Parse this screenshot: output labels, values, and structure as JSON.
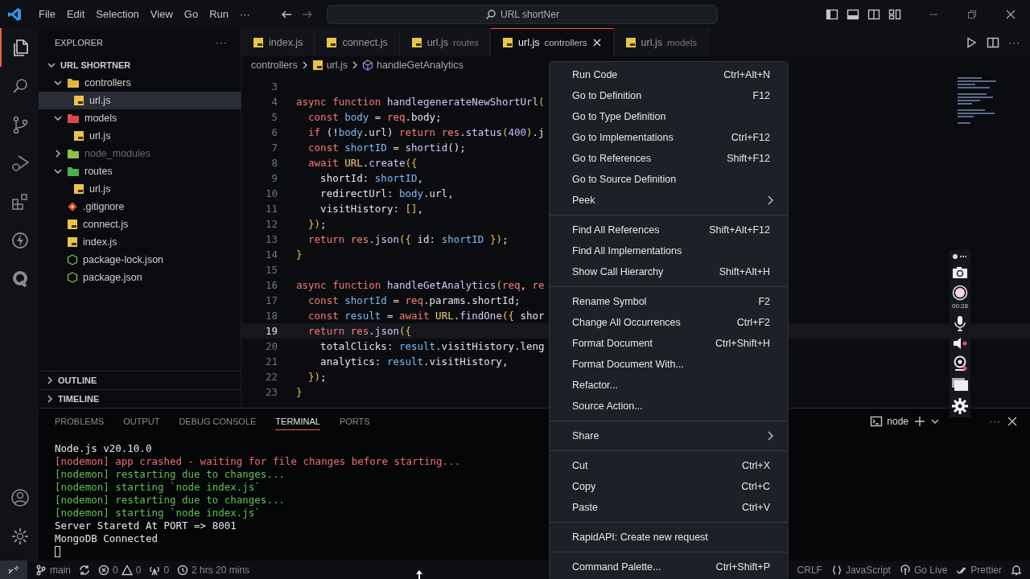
{
  "title_bar": {
    "menus": [
      "File",
      "Edit",
      "Selection",
      "View",
      "Go",
      "Run",
      "···"
    ],
    "search": "URL shortNer"
  },
  "explorer": {
    "title": "EXPLORER",
    "more": "···",
    "root": {
      "label": "URL SHORTNER",
      "expanded": true
    },
    "tree": [
      {
        "label": "controllers",
        "kind": "folder",
        "color": "#e2b63a",
        "expanded": true,
        "selected": false,
        "ignored": false,
        "children": [
          {
            "label": "url.js",
            "kind": "js",
            "selected": true,
            "ignored": false
          }
        ]
      },
      {
        "label": "models",
        "kind": "folder",
        "color": "#e0474f",
        "expanded": true,
        "selected": false,
        "ignored": false,
        "children": [
          {
            "label": "url.js",
            "kind": "js",
            "selected": false,
            "ignored": false
          }
        ]
      },
      {
        "label": "node_modules",
        "kind": "folder",
        "color": "#8bc34a",
        "expanded": false,
        "selected": false,
        "ignored": true
      },
      {
        "label": "routes",
        "kind": "folder",
        "color": "#4caf50",
        "expanded": true,
        "selected": false,
        "ignored": false,
        "children": [
          {
            "label": "url.js",
            "kind": "js",
            "selected": false,
            "ignored": false
          }
        ]
      },
      {
        "label": ".gitignore",
        "kind": "git",
        "selected": false,
        "ignored": false
      },
      {
        "label": "connect.js",
        "kind": "js",
        "selected": false,
        "ignored": false
      },
      {
        "label": "index.js",
        "kind": "js",
        "selected": false,
        "ignored": false
      },
      {
        "label": "package-lock.json",
        "kind": "npm",
        "selected": false,
        "ignored": false
      },
      {
        "label": "package.json",
        "kind": "npm",
        "selected": false,
        "ignored": false
      }
    ],
    "sections": [
      {
        "label": "OUTLINE",
        "expanded": false
      },
      {
        "label": "TIMELINE",
        "expanded": false
      }
    ]
  },
  "tabs": [
    {
      "label": "index.js",
      "selected": false
    },
    {
      "label": "connect.js",
      "selected": false
    },
    {
      "label": "url.js",
      "description": "routes",
      "selected": false
    },
    {
      "label": "url.js",
      "description": "controllers",
      "selected": true
    },
    {
      "label": "url.js",
      "description": "models",
      "selected": false
    }
  ],
  "breadcrumb": [
    {
      "label": "controllers",
      "kind": "folder"
    },
    {
      "label": "url.js",
      "kind": "js"
    },
    {
      "label": "handleGetAnalytics",
      "kind": "symbol"
    }
  ],
  "code": {
    "lines": [
      {
        "number": "3",
        "current": false
      },
      {
        "number": "4",
        "current": false,
        "tokens": [
          {
            "text": "async",
            "kind": "kw"
          },
          {
            "text": " function",
            "kind": "kw"
          },
          {
            "text": " handlegenerateNewShortUrl",
            "kind": "fn"
          },
          {
            "text": "(",
            "kind": "brace"
          }
        ]
      },
      {
        "number": "5",
        "current": false,
        "tokens": [
          {
            "text": "  const",
            "kind": "kw"
          },
          {
            "text": " body",
            "kind": "var"
          },
          {
            "text": " = ",
            "kind": "plain"
          },
          {
            "text": "req",
            "kind": "obj"
          },
          {
            "text": ".body;",
            "kind": "plain"
          }
        ]
      },
      {
        "number": "6",
        "current": false,
        "tokens": [
          {
            "text": "  if",
            "kind": "kw"
          },
          {
            "text": " (!",
            "kind": "plain"
          },
          {
            "text": "body",
            "kind": "var"
          },
          {
            "text": ".url) ",
            "kind": "plain"
          },
          {
            "text": "return",
            "kind": "kw"
          },
          {
            "text": " res",
            "kind": "obj"
          },
          {
            "text": ".",
            "kind": "plain"
          },
          {
            "text": "status",
            "kind": "fn"
          },
          {
            "text": "(",
            "kind": "brace"
          },
          {
            "text": "400",
            "kind": "num"
          },
          {
            "text": ")",
            "kind": "brace"
          },
          {
            "text": ".j",
            "kind": "plain"
          }
        ]
      },
      {
        "number": "7",
        "current": false,
        "tokens": [
          {
            "text": "  const",
            "kind": "kw"
          },
          {
            "text": " shortID",
            "kind": "var"
          },
          {
            "text": " = ",
            "kind": "plain"
          },
          {
            "text": "shortid",
            "kind": "fn"
          },
          {
            "text": "();",
            "kind": "plain"
          }
        ]
      },
      {
        "number": "8",
        "current": false,
        "tokens": [
          {
            "text": "  await",
            "kind": "kw"
          },
          {
            "text": " URL",
            "kind": "cls"
          },
          {
            "text": ".",
            "kind": "plain"
          },
          {
            "text": "create",
            "kind": "fn"
          },
          {
            "text": "({",
            "kind": "brace"
          }
        ]
      },
      {
        "number": "9",
        "current": false,
        "tokens": [
          {
            "text": "    shortId: ",
            "kind": "plain"
          },
          {
            "text": "shortID",
            "kind": "var"
          },
          {
            "text": ",",
            "kind": "plain"
          }
        ]
      },
      {
        "number": "10",
        "current": false,
        "tokens": [
          {
            "text": "    redirectUrl: ",
            "kind": "plain"
          },
          {
            "text": "body",
            "kind": "var"
          },
          {
            "text": ".url,",
            "kind": "plain"
          }
        ]
      },
      {
        "number": "11",
        "current": false,
        "tokens": [
          {
            "text": "    visitHistory: ",
            "kind": "plain"
          },
          {
            "text": "[]",
            "kind": "brace"
          },
          {
            "text": ",",
            "kind": "plain"
          }
        ]
      },
      {
        "number": "12",
        "current": false,
        "tokens": [
          {
            "text": "  })",
            "kind": "brace"
          },
          {
            "text": ";",
            "kind": "plain"
          }
        ]
      },
      {
        "number": "13",
        "current": false,
        "tokens": [
          {
            "text": "  return",
            "kind": "kw"
          },
          {
            "text": " res",
            "kind": "obj"
          },
          {
            "text": ".",
            "kind": "plain"
          },
          {
            "text": "json",
            "kind": "fn"
          },
          {
            "text": "({",
            "kind": "brace"
          },
          {
            "text": " id: ",
            "kind": "plain"
          },
          {
            "text": "shortID",
            "kind": "var"
          },
          {
            "text": " })",
            "kind": "brace"
          },
          {
            "text": ";",
            "kind": "plain"
          }
        ]
      },
      {
        "number": "14",
        "current": false,
        "tokens": [
          {
            "text": "}",
            "kind": "brace"
          }
        ]
      },
      {
        "number": "15",
        "current": false
      },
      {
        "number": "16",
        "current": false,
        "tokens": [
          {
            "text": "async",
            "kind": "kw"
          },
          {
            "text": " function",
            "kind": "kw"
          },
          {
            "text": " handleGetAnalytics",
            "kind": "fn"
          },
          {
            "text": "(",
            "kind": "brace"
          },
          {
            "text": "req",
            "kind": "obj"
          },
          {
            "text": ", ",
            "kind": "plain"
          },
          {
            "text": "re",
            "kind": "obj"
          }
        ]
      },
      {
        "number": "17",
        "current": false,
        "tokens": [
          {
            "text": "  const",
            "kind": "kw"
          },
          {
            "text": " shortId",
            "kind": "var"
          },
          {
            "text": " = ",
            "kind": "plain"
          },
          {
            "text": "req",
            "kind": "obj"
          },
          {
            "text": ".params.shortId;",
            "kind": "plain"
          }
        ]
      },
      {
        "number": "18",
        "current": false,
        "tokens": [
          {
            "text": "  const",
            "kind": "kw"
          },
          {
            "text": " result",
            "kind": "var"
          },
          {
            "text": " = ",
            "kind": "plain"
          },
          {
            "text": "await",
            "kind": "kw"
          },
          {
            "text": " URL",
            "kind": "cls"
          },
          {
            "text": ".",
            "kind": "plain"
          },
          {
            "text": "findOne",
            "kind": "fn"
          },
          {
            "text": "({",
            "kind": "brace"
          },
          {
            "text": " shor",
            "kind": "plain"
          }
        ]
      },
      {
        "number": "19",
        "current": true,
        "tokens": [
          {
            "text": "  return",
            "kind": "kw"
          },
          {
            "text": " res",
            "kind": "obj"
          },
          {
            "text": ".",
            "kind": "plain"
          },
          {
            "text": "json",
            "kind": "fn"
          },
          {
            "text": "({",
            "kind": "brace"
          }
        ]
      },
      {
        "number": "20",
        "current": false,
        "tokens": [
          {
            "text": "    totalClicks: ",
            "kind": "plain"
          },
          {
            "text": "result",
            "kind": "var"
          },
          {
            "text": ".visitHistory.leng",
            "kind": "plain"
          }
        ]
      },
      {
        "number": "21",
        "current": false,
        "tokens": [
          {
            "text": "    analytics: ",
            "kind": "plain"
          },
          {
            "text": "result",
            "kind": "var"
          },
          {
            "text": ".visitHistory,",
            "kind": "plain"
          }
        ]
      },
      {
        "number": "22",
        "current": false,
        "tokens": [
          {
            "text": "  })",
            "kind": "brace"
          },
          {
            "text": ";",
            "kind": "plain"
          }
        ]
      },
      {
        "number": "23",
        "current": false,
        "tokens": [
          {
            "text": "}",
            "kind": "brace"
          }
        ]
      }
    ]
  },
  "panel": {
    "tabs": [
      {
        "label": "PROBLEMS",
        "selected": false
      },
      {
        "label": "OUTPUT",
        "selected": false
      },
      {
        "label": "DEBUG CONSOLE",
        "selected": false
      },
      {
        "label": "TERMINAL",
        "selected": true
      },
      {
        "label": "PORTS",
        "selected": false
      }
    ],
    "terminal_name": "node",
    "more": "···",
    "lines": [
      {
        "text": "Node.js v20.10.0",
        "kind": "plain"
      },
      {
        "text": "[nodemon] app crashed - waiting for file changes before starting...",
        "kind": "error"
      },
      {
        "text": "[nodemon] restarting due to changes...",
        "kind": "info"
      },
      {
        "text": "[nodemon] starting `node index.js`",
        "kind": "info"
      },
      {
        "text": "[nodemon] restarting due to changes...",
        "kind": "info"
      },
      {
        "text": "[nodemon] starting `node index.js`",
        "kind": "info"
      },
      {
        "text": "Server Staretd At PORT => 8001",
        "kind": "plain"
      },
      {
        "text": "MongoDB Connected",
        "kind": "plain"
      }
    ]
  },
  "context_menu": {
    "groups": [
      [
        {
          "label": "Run Code",
          "shortcut": "Ctrl+Alt+N",
          "submenu": false
        },
        {
          "label": "Go to Definition",
          "shortcut": "F12",
          "submenu": false
        },
        {
          "label": "Go to Type Definition",
          "submenu": false
        },
        {
          "label": "Go to Implementations",
          "shortcut": "Ctrl+F12",
          "submenu": false
        },
        {
          "label": "Go to References",
          "shortcut": "Shift+F12",
          "submenu": false
        },
        {
          "label": "Go to Source Definition",
          "submenu": false
        },
        {
          "label": "Peek",
          "submenu": true
        }
      ],
      [
        {
          "label": "Find All References",
          "shortcut": "Shift+Alt+F12",
          "submenu": false
        },
        {
          "label": "Find All Implementations",
          "submenu": false
        },
        {
          "label": "Show Call Hierarchy",
          "shortcut": "Shift+Alt+H",
          "submenu": false
        }
      ],
      [
        {
          "label": "Rename Symbol",
          "shortcut": "F2",
          "submenu": false
        },
        {
          "label": "Change All Occurrences",
          "shortcut": "Ctrl+F2",
          "submenu": false
        },
        {
          "label": "Format Document",
          "shortcut": "Ctrl+Shift+H",
          "submenu": false
        },
        {
          "label": "Format Document With...",
          "submenu": false
        },
        {
          "label": "Refactor...",
          "submenu": false
        },
        {
          "label": "Source Action...",
          "submenu": false
        }
      ],
      [
        {
          "label": "Share",
          "submenu": true
        }
      ],
      [
        {
          "label": "Cut",
          "shortcut": "Ctrl+X",
          "submenu": false
        },
        {
          "label": "Copy",
          "shortcut": "Ctrl+C",
          "submenu": false
        },
        {
          "label": "Paste",
          "shortcut": "Ctrl+V",
          "submenu": false
        }
      ],
      [
        {
          "label": "RapidAPI: Create new request",
          "submenu": false
        }
      ],
      [
        {
          "label": "Command Palette...",
          "shortcut": "Ctrl+Shift+P",
          "submenu": false
        }
      ]
    ]
  },
  "status_bar": {
    "branch": "main",
    "errors": "0",
    "warnings": "0",
    "ports": "0",
    "timer": "2 hrs 20 mins",
    "right": [
      {
        "label": "CRLF",
        "kind": "plain"
      },
      {
        "label": "JavaScript",
        "kind": "language"
      },
      {
        "label": "Go Live",
        "kind": "live"
      },
      {
        "label": "Prettier",
        "kind": "prettier"
      }
    ]
  },
  "recorder": {
    "elapsed": "00:28"
  }
}
